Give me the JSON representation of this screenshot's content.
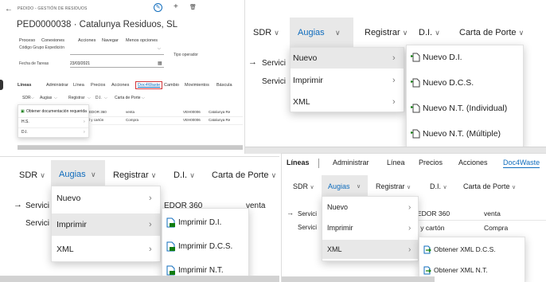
{
  "p1": {
    "breadcrumb": "PEDIDO - GESTIÓN DE RESIDUOS",
    "title": "PED0000038 · Catalunya Residuos, SL",
    "actions": [
      "Proceso",
      "Conexiones",
      "Acciones",
      "Navegar",
      "Menos opciones"
    ],
    "fields": [
      {
        "label": "Código Grupo Expedición",
        "value": ""
      },
      {
        "label": "Tipo operador",
        "value": ""
      },
      {
        "label": "Fecha de Tareas",
        "value": "23/03/2021"
      }
    ],
    "line_tabs": [
      "Líneas",
      "Administrar",
      "Línea",
      "Precios",
      "Acciones",
      "Doc4Waste",
      "Cambio",
      "Movimientos",
      "Báscula"
    ],
    "sub_tabs": [
      "SDR",
      "Augias",
      "Registrar",
      "D.I.",
      "Carta de Porte"
    ],
    "dropdown": [
      "Obtener documentación requerida",
      "H.S.",
      "D.I."
    ],
    "table_rows": [
      [
        "EDOR 360",
        "venta",
        "VEH00006",
        "Catalunya Re"
      ],
      [
        "l y cartón",
        "Compra",
        "VEH00006",
        "Catalunya Re"
      ]
    ]
  },
  "p2": {
    "tabs": [
      "SDR",
      "Augias",
      "Registrar",
      "D.I.",
      "Carta de Porte"
    ],
    "rows": [
      "Servici",
      "Servici"
    ],
    "menu": [
      "Nuevo",
      "Imprimir",
      "XML"
    ],
    "submenu": [
      "Nuevo D.I.",
      "Nuevo D.C.S.",
      "Nuevo N.T. (Individual)",
      "Nuevo N.T. (Múltiple)"
    ]
  },
  "p3": {
    "tabs": [
      "SDR",
      "Augias",
      "Registrar",
      "D.I.",
      "Carta de Porte"
    ],
    "rows": [
      "Servici",
      "Servici"
    ],
    "cell": "EDOR 360",
    "cell2": "venta",
    "menu": [
      "Nuevo",
      "Imprimir",
      "XML"
    ],
    "submenu": [
      "Imprimir D.I.",
      "Imprimir D.C.S.",
      "Imprimir N.T."
    ]
  },
  "p4": {
    "line_tabs": [
      "Líneas",
      "Administrar",
      "Línea",
      "Precios",
      "Acciones",
      "Doc4Waste"
    ],
    "tabs": [
      "SDR",
      "Augias",
      "Registrar",
      "D.I.",
      "Carta de Porte"
    ],
    "rows": [
      "Servici",
      "Servici"
    ],
    "cells": [
      [
        "EDOR 360",
        "venta"
      ],
      [
        "l y cartón",
        "Compra"
      ]
    ],
    "menu": [
      "Nuevo",
      "Imprimir",
      "XML"
    ],
    "submenu": [
      "Obtener XML D.C.S.",
      "Obtener XML N.T."
    ]
  },
  "colors": {
    "accent": "#0f6cbd",
    "highlight_box": "#d13438",
    "icon_green": "#107c10"
  }
}
